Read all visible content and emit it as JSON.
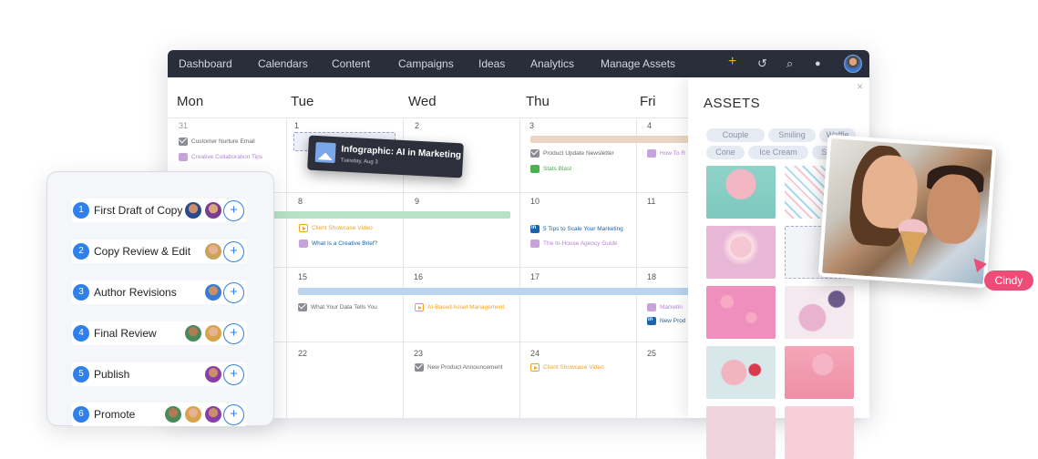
{
  "nav": {
    "items": [
      "Dashboard",
      "Calendars",
      "Content",
      "Campaigns",
      "Ideas",
      "Analytics",
      "Manage Assets"
    ],
    "icons": [
      "plus-icon",
      "history-icon",
      "search-icon",
      "bell-icon"
    ],
    "accent": "#f3a421"
  },
  "calendar": {
    "days": [
      "Mon",
      "Tue",
      "Wed",
      "Thu",
      "Fri"
    ],
    "dates": [
      [
        "31",
        "1",
        "2",
        "3",
        "4"
      ],
      [
        "7",
        "8",
        "9",
        "10",
        "11"
      ],
      [
        "14",
        "15",
        "16",
        "17",
        "18"
      ],
      [
        "21",
        "22",
        "23",
        "24",
        "25"
      ]
    ],
    "events": {
      "e1": "Customer Nurture Email",
      "e2": "Creative Collaboration Tips",
      "e3": "Product Update Newsletter",
      "e4": "Stats Blast",
      "e5": "How To R",
      "e6": "Client Showcase Video",
      "e7": "What Is a Creative Brief?",
      "e8": "5 Tips to Scale Your Marketing",
      "e9": "The In-House Agency Guide",
      "e10": "What Your Data Tells You",
      "e11": "AI-Based Asset Management",
      "e12": "Marketin",
      "e13": "New Prod",
      "e14": "New Product Announcement",
      "e15": "Client Showcase Video"
    },
    "drag_card": {
      "title": "Infographic: AI in Marketing",
      "date": "Tuesday, Aug 3"
    }
  },
  "assets": {
    "title": "ASSETS",
    "tags": [
      "Couple",
      "Smiling",
      "Waffle",
      "Cone",
      "Ice Cream",
      "Sprinkl"
    ],
    "close": "×",
    "cursor_label": "Cindy"
  },
  "workflow": {
    "steps": [
      {
        "num": "1",
        "label": "First Draft of Copy"
      },
      {
        "num": "2",
        "label": "Copy Review & Edit"
      },
      {
        "num": "3",
        "label": "Author Revisions"
      },
      {
        "num": "4",
        "label": "Final Review"
      },
      {
        "num": "5",
        "label": "Publish"
      },
      {
        "num": "6",
        "label": "Promote"
      }
    ],
    "add": "+"
  }
}
